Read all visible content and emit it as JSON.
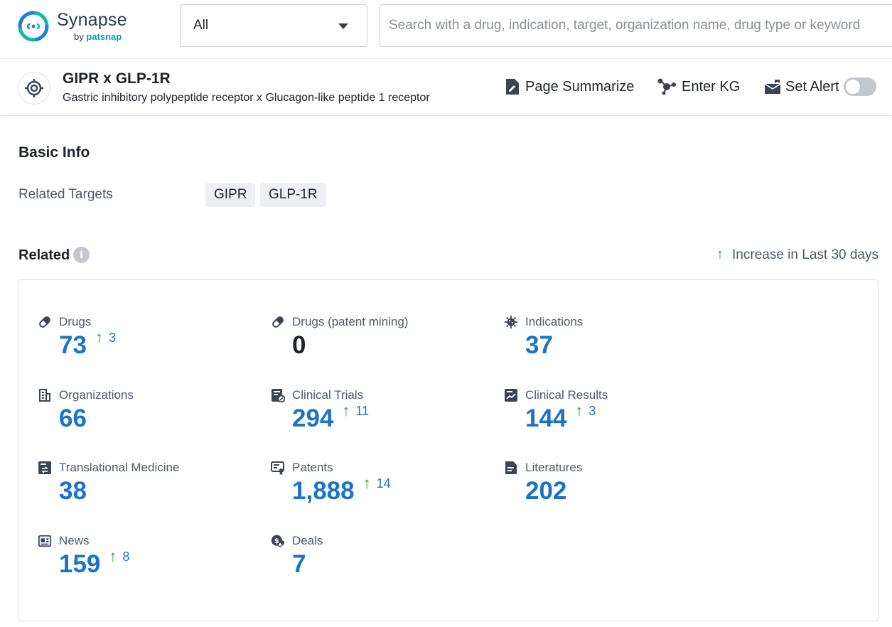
{
  "app": {
    "logo_name": "Synapse",
    "logo_by": "by",
    "logo_brand": "patsnap",
    "brand_color": "#00a39a"
  },
  "search": {
    "scope_value": "All",
    "placeholder": "Search with a drug, indication, target, organization name, drug type or keyword"
  },
  "target": {
    "title": "GIPR x GLP-1R",
    "subtitle": "Gastric inhibitory polypeptide receptor x Glucagon-like peptide 1 receptor",
    "icon": "target-icon"
  },
  "actions": {
    "page_summarize": "Page Summarize",
    "enter_kg": "Enter KG",
    "set_alert": "Set Alert",
    "set_alert_on": false
  },
  "basic_info": {
    "title": "Basic Info",
    "related_targets_label": "Related Targets",
    "related_targets": [
      "GIPR",
      "GLP-1R"
    ]
  },
  "related": {
    "title": "Related",
    "legend": "Increase in Last 30 days",
    "accent_color": "#1a73c9",
    "increase_color": "#2e9a3c",
    "stats": [
      {
        "label": "Drugs",
        "icon": "pill-icon",
        "value": "73",
        "increase": "3"
      },
      {
        "label": "Drugs (patent mining)",
        "icon": "pill-icon",
        "value": "0",
        "increase": ""
      },
      {
        "label": "Indications",
        "icon": "virus-icon",
        "value": "37",
        "increase": ""
      },
      {
        "label": "Organizations",
        "icon": "building-icon",
        "value": "66",
        "increase": ""
      },
      {
        "label": "Clinical Trials",
        "icon": "clinical-trial-icon",
        "value": "294",
        "increase": "11"
      },
      {
        "label": "Clinical Results",
        "icon": "chart-doc-icon",
        "value": "144",
        "increase": "3"
      },
      {
        "label": "Translational Medicine",
        "icon": "translational-icon",
        "value": "38",
        "increase": ""
      },
      {
        "label": "Patents",
        "icon": "patent-icon",
        "value": "1,888",
        "increase": "14"
      },
      {
        "label": "Literatures",
        "icon": "document-icon",
        "value": "202",
        "increase": ""
      },
      {
        "label": "News",
        "icon": "news-icon",
        "value": "159",
        "increase": "8"
      },
      {
        "label": "Deals",
        "icon": "deal-icon",
        "value": "7",
        "increase": ""
      }
    ]
  }
}
